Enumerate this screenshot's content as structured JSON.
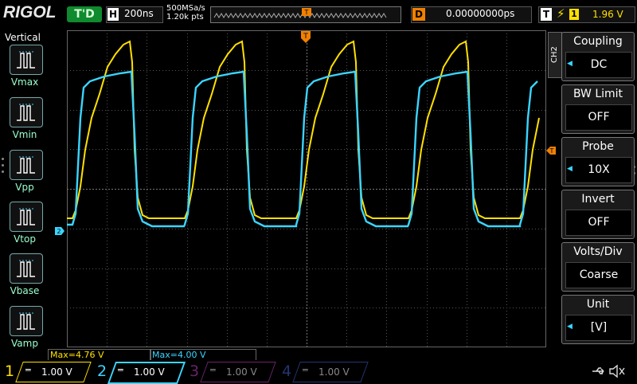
{
  "brand": "RIGOL",
  "status": "T'D",
  "timebase": {
    "letter": "H",
    "value": "200ns"
  },
  "sampling": {
    "rate": "500MSa/s",
    "points": "1.20k pts"
  },
  "trigger_marker": "T",
  "delay": {
    "letter": "D",
    "value": "0.00000000ps"
  },
  "trigger": {
    "letter": "T",
    "slope": "⚡",
    "channel": "1",
    "level": "1.96 V"
  },
  "left_panel": {
    "title": "Vertical",
    "items": [
      {
        "label": "Vmax"
      },
      {
        "label": "Vmin"
      },
      {
        "label": "Vpp"
      },
      {
        "label": "Vtop"
      },
      {
        "label": "Vbase"
      },
      {
        "label": "Vamp"
      }
    ]
  },
  "right_menu": {
    "tab": "CH2",
    "items": [
      {
        "title": "Coupling",
        "value": "DC",
        "arrow": true
      },
      {
        "title": "BW Limit",
        "value": "OFF",
        "arrow": false
      },
      {
        "title": "Probe",
        "value": "10X",
        "arrow": true
      },
      {
        "title": "Invert",
        "value": "OFF",
        "arrow": false
      },
      {
        "title": "Volts/Div",
        "value": "Coarse",
        "arrow": false
      },
      {
        "title": "Unit",
        "value": "[V]",
        "arrow": true
      }
    ]
  },
  "measurements": [
    {
      "text": "Max=4.76 V",
      "color": "#ffe000"
    },
    {
      "text": "Max=4.00 V",
      "color": "#3bd5ff"
    }
  ],
  "channels": [
    {
      "num": "1",
      "scale": "1.00 V",
      "color": "#ffe000",
      "active": true
    },
    {
      "num": "2",
      "scale": "1.00 V",
      "color": "#3bd5ff",
      "active": true
    },
    {
      "num": "3",
      "scale": "1.00 V",
      "color": "#c040c0",
      "active": false
    },
    {
      "num": "4",
      "scale": "1.00 V",
      "color": "#4060d0",
      "active": false
    }
  ],
  "ch2_marker": "2",
  "icons": [
    "usb-icon",
    "speaker-muted-icon"
  ],
  "colors": {
    "ch1": "#ffe000",
    "ch2": "#3bd5ff",
    "trigger": "#f08000",
    "run": "#0f8a2e"
  }
}
